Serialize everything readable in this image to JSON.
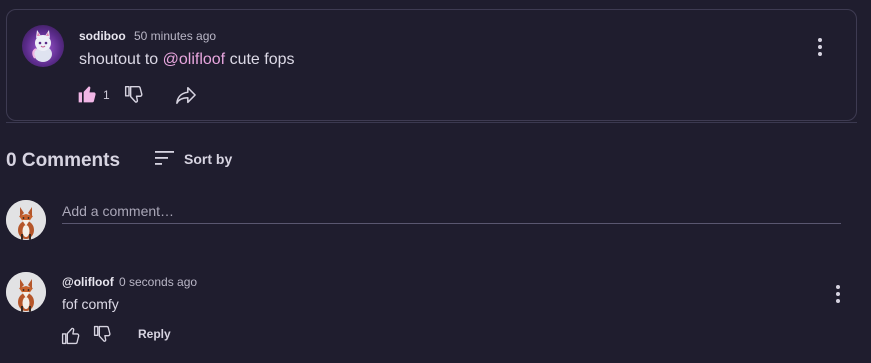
{
  "post": {
    "username": "sodiboo",
    "time": "50 minutes ago",
    "text_prefix": "shoutout to ",
    "mention": "@olifloof",
    "text_suffix": " cute fops",
    "like_count": "1",
    "avatar_icon": "cat-avatar-icon",
    "liked": true,
    "colors": {
      "liked_thumb": "#f1b6e6",
      "mention": "#e8a6de"
    }
  },
  "comments_section": {
    "title": "0 Comments",
    "sort_label": "Sort by",
    "input_placeholder": "Add a comment…"
  },
  "comments": [
    {
      "username": "@olifloof",
      "time": "0 seconds ago",
      "text": "fof comfy",
      "reply_label": "Reply",
      "avatar_icon": "fox-avatar-icon"
    }
  ],
  "colors": {
    "background": "#1f1d2e",
    "border": "#3e3b52"
  }
}
